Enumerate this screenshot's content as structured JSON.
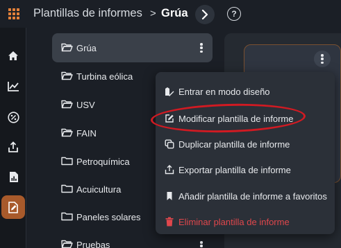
{
  "header": {
    "breadcrumb_root": "Plantillas de informes",
    "breadcrumb_separator": ">",
    "breadcrumb_current": "Grúa",
    "help_label": "?"
  },
  "rail": {
    "items": [
      {
        "icon": "home-icon"
      },
      {
        "icon": "trend-chart-icon"
      },
      {
        "icon": "percent-icon"
      },
      {
        "icon": "upload-icon"
      },
      {
        "icon": "report-chart-icon"
      },
      {
        "icon": "edit-report-icon",
        "active": true
      }
    ]
  },
  "tree": {
    "items": [
      {
        "label": "Grúa",
        "selected": true
      },
      {
        "label": "Turbina eólica"
      },
      {
        "label": "USV"
      },
      {
        "label": "FAIN"
      },
      {
        "label": "Petroquímica"
      },
      {
        "label": "Acuicultura"
      },
      {
        "label": "Paneles solares"
      },
      {
        "label": "Pruebas"
      }
    ]
  },
  "context_menu": {
    "items": [
      {
        "label": "Entrar en modo diseño",
        "icon": "design-mode-icon"
      },
      {
        "label": "Modificar plantilla de informe",
        "icon": "edit-icon",
        "highlighted": true
      },
      {
        "label": "Duplicar plantilla de informe",
        "icon": "duplicate-icon"
      },
      {
        "label": "Exportar plantilla de informe",
        "icon": "export-icon"
      },
      {
        "label": "Añadir plantilla de informe a favoritos",
        "icon": "bookmark-icon"
      },
      {
        "label": "Eliminar plantilla de informe",
        "icon": "trash-icon",
        "danger": true
      }
    ]
  },
  "colors": {
    "accent": "#e3813a",
    "active_rail": "#a85a2b",
    "danger": "#e0474c",
    "highlight_ring": "#d11a22"
  }
}
